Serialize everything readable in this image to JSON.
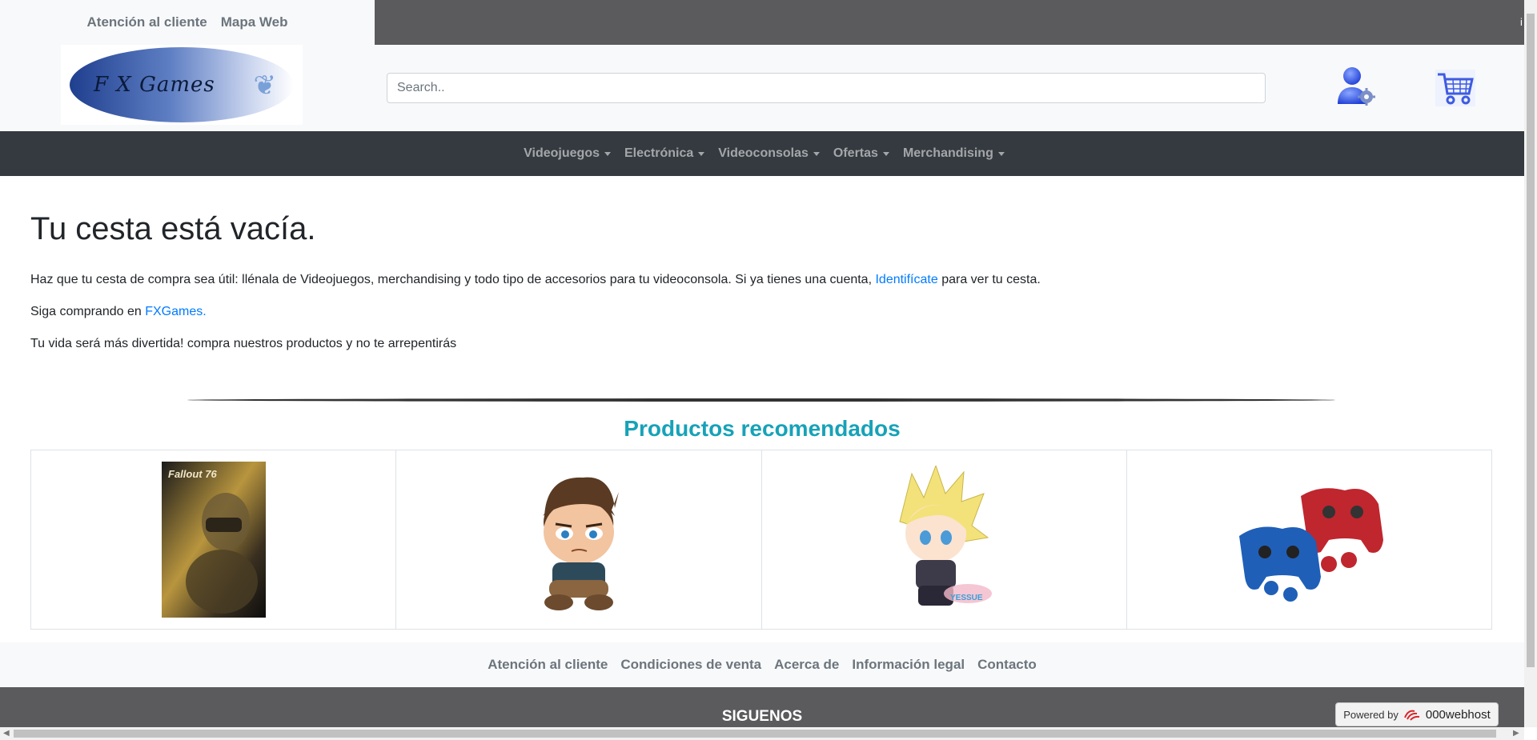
{
  "top_links": [
    "Atención al cliente",
    "Mapa Web"
  ],
  "logo": {
    "text": "F X Games"
  },
  "search": {
    "placeholder": "Search.."
  },
  "nav": [
    "Videojuegos",
    "Electrónica",
    "Videoconsolas",
    "Ofertas",
    "Merchandising"
  ],
  "cart": {
    "title": "Tu cesta está vacía.",
    "p1_before": "Haz que tu cesta de compra sea útil: llénala de Videojuegos, merchandising y todo tipo de accesorios para tu videoconsola. Si ya tienes una cuenta, ",
    "p1_link": "Identifícate",
    "p1_after": " para ver tu cesta.",
    "p2_before": "Siga comprando en ",
    "p2_link": "FXGames.",
    "p3": "Tu vida será más divertida! compra nuestros productos y no te arrepentirás"
  },
  "recommended": {
    "title": "Productos recomendados",
    "products": [
      {
        "name": "fallout-76-game-cover",
        "cover_label": "Fallout 76"
      },
      {
        "name": "nathan-drake-plush"
      },
      {
        "name": "cloud-strife-plush"
      },
      {
        "name": "controller-skins-blue-red"
      }
    ]
  },
  "footer": {
    "links": [
      "Atención al cliente",
      "Condiciones de venta",
      "Acerca de",
      "Información legal",
      "Contacto"
    ],
    "siguenos": "SIGUENOS",
    "powered_by": "Powered by",
    "host": "000webhost"
  },
  "colors": {
    "nav_bg": "#343a40",
    "accent_title": "#17a2b8",
    "link": "#007bff",
    "top_dark": "#5b5b5d"
  }
}
